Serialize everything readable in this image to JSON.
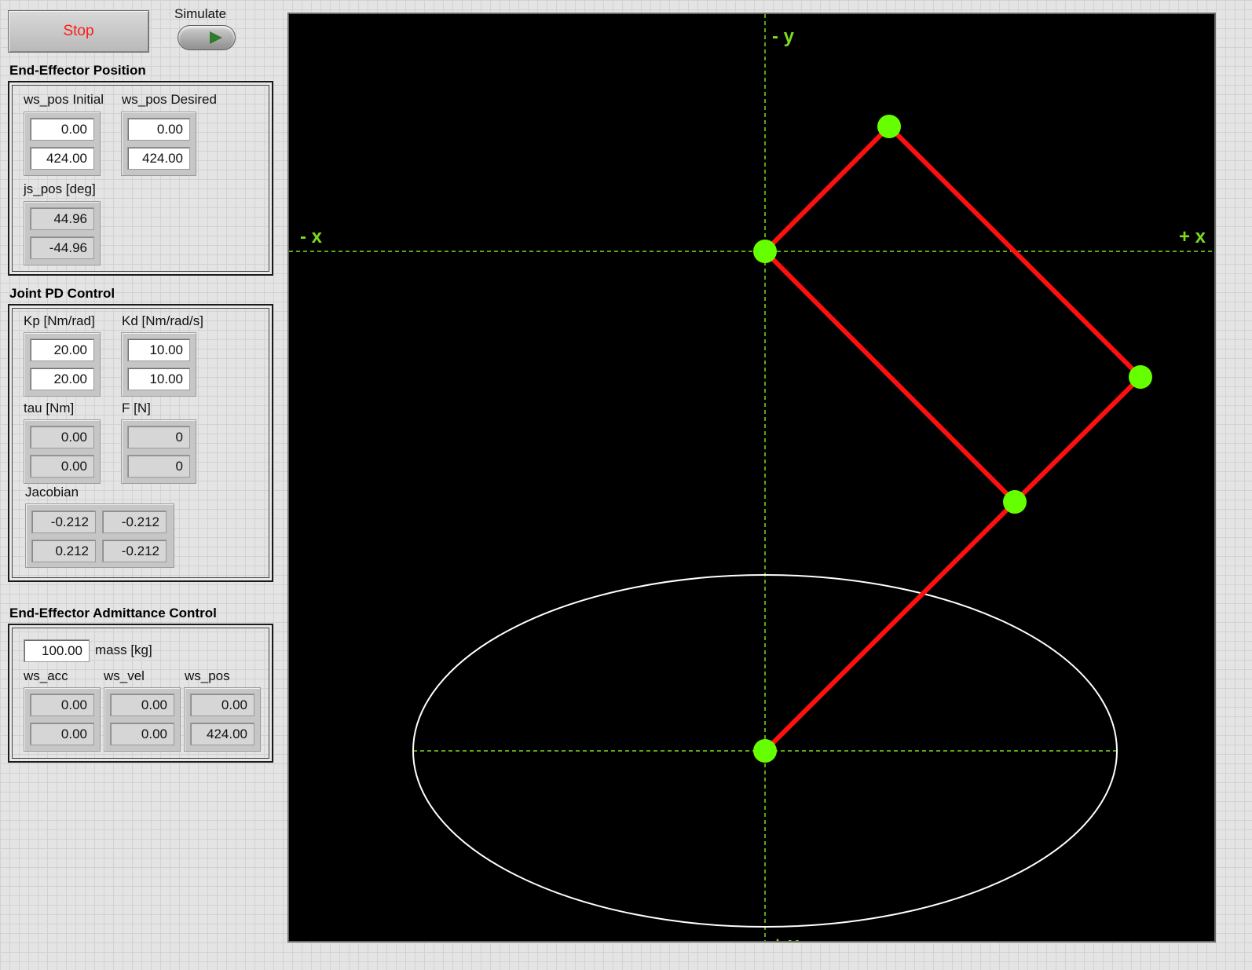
{
  "controls": {
    "stop_label": "Stop",
    "simulate_label": "Simulate"
  },
  "end_effector_position": {
    "title": "End-Effector Position",
    "ws_pos_initial_label": "ws_pos Initial",
    "ws_pos_desired_label": "ws_pos Desired",
    "ws_pos_initial": [
      "0.00",
      "424.00"
    ],
    "ws_pos_desired": [
      "0.00",
      "424.00"
    ],
    "js_pos_label": "js_pos [deg]",
    "js_pos": [
      "44.96",
      "-44.96"
    ]
  },
  "joint_pd_control": {
    "title": "Joint PD Control",
    "kp_label": "Kp [Nm/rad]",
    "kd_label": "Kd [Nm/rad/s]",
    "kp": [
      "20.00",
      "20.00"
    ],
    "kd": [
      "10.00",
      "10.00"
    ],
    "tau_label": "tau [Nm]",
    "f_label": "F [N]",
    "tau": [
      "0.00",
      "0.00"
    ],
    "f": [
      "0",
      "0"
    ],
    "jacobian_label": "Jacobian",
    "jacobian": [
      [
        "-0.212",
        "-0.212"
      ],
      [
        "0.212",
        "-0.212"
      ]
    ]
  },
  "admittance_control": {
    "title": "End-Effector Admittance Control",
    "mass_value": "100.00",
    "mass_label": "mass [kg]",
    "ws_acc_label": "ws_acc",
    "ws_vel_label": "ws_vel",
    "ws_pos_label": "ws_pos",
    "ws_acc": [
      "0.00",
      "0.00"
    ],
    "ws_vel": [
      "0.00",
      "0.00"
    ],
    "ws_pos": [
      "0.00",
      "424.00"
    ]
  },
  "plot": {
    "axis_labels": {
      "neg_y": "- y",
      "pos_y": "+ y",
      "neg_x": "- x",
      "pos_x": "+ x"
    },
    "colors": {
      "background": "#000000",
      "axes": "#7ddc1f",
      "links": "#ff1010",
      "joints": "#66ff00",
      "workspace": "#ffffff"
    }
  }
}
